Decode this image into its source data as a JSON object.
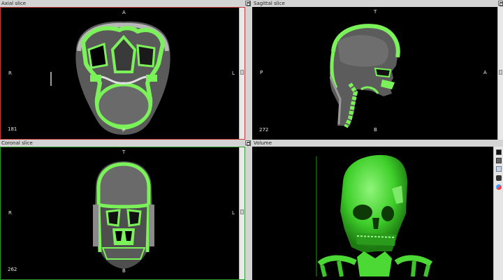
{
  "panes": {
    "axial": {
      "title": "Axial slice",
      "orient_top": "A",
      "orient_bottom": "P",
      "orient_left": "R",
      "orient_right": "L",
      "slice": "181"
    },
    "sagittal": {
      "title": "Sagittal slice",
      "orient_top": "T",
      "orient_bottom": "B",
      "orient_left": "P",
      "orient_right": "A",
      "slice": "272"
    },
    "coronal": {
      "title": "Coronal slice",
      "orient_top": "T",
      "orient_bottom": "B",
      "orient_left": "R",
      "orient_right": "L",
      "slice": "262"
    },
    "volume": {
      "title": "Volume"
    }
  },
  "colors": {
    "segmentation": "#7cf25a",
    "volume_render": "#52e33a",
    "axial_border": "#c23a3a",
    "coronal_border": "#2d9b2d"
  },
  "toolbar_icons": [
    "background-color-icon",
    "render-preset-icon",
    "screenshot-icon",
    "camera-reset-icon",
    "color-map-icon"
  ]
}
